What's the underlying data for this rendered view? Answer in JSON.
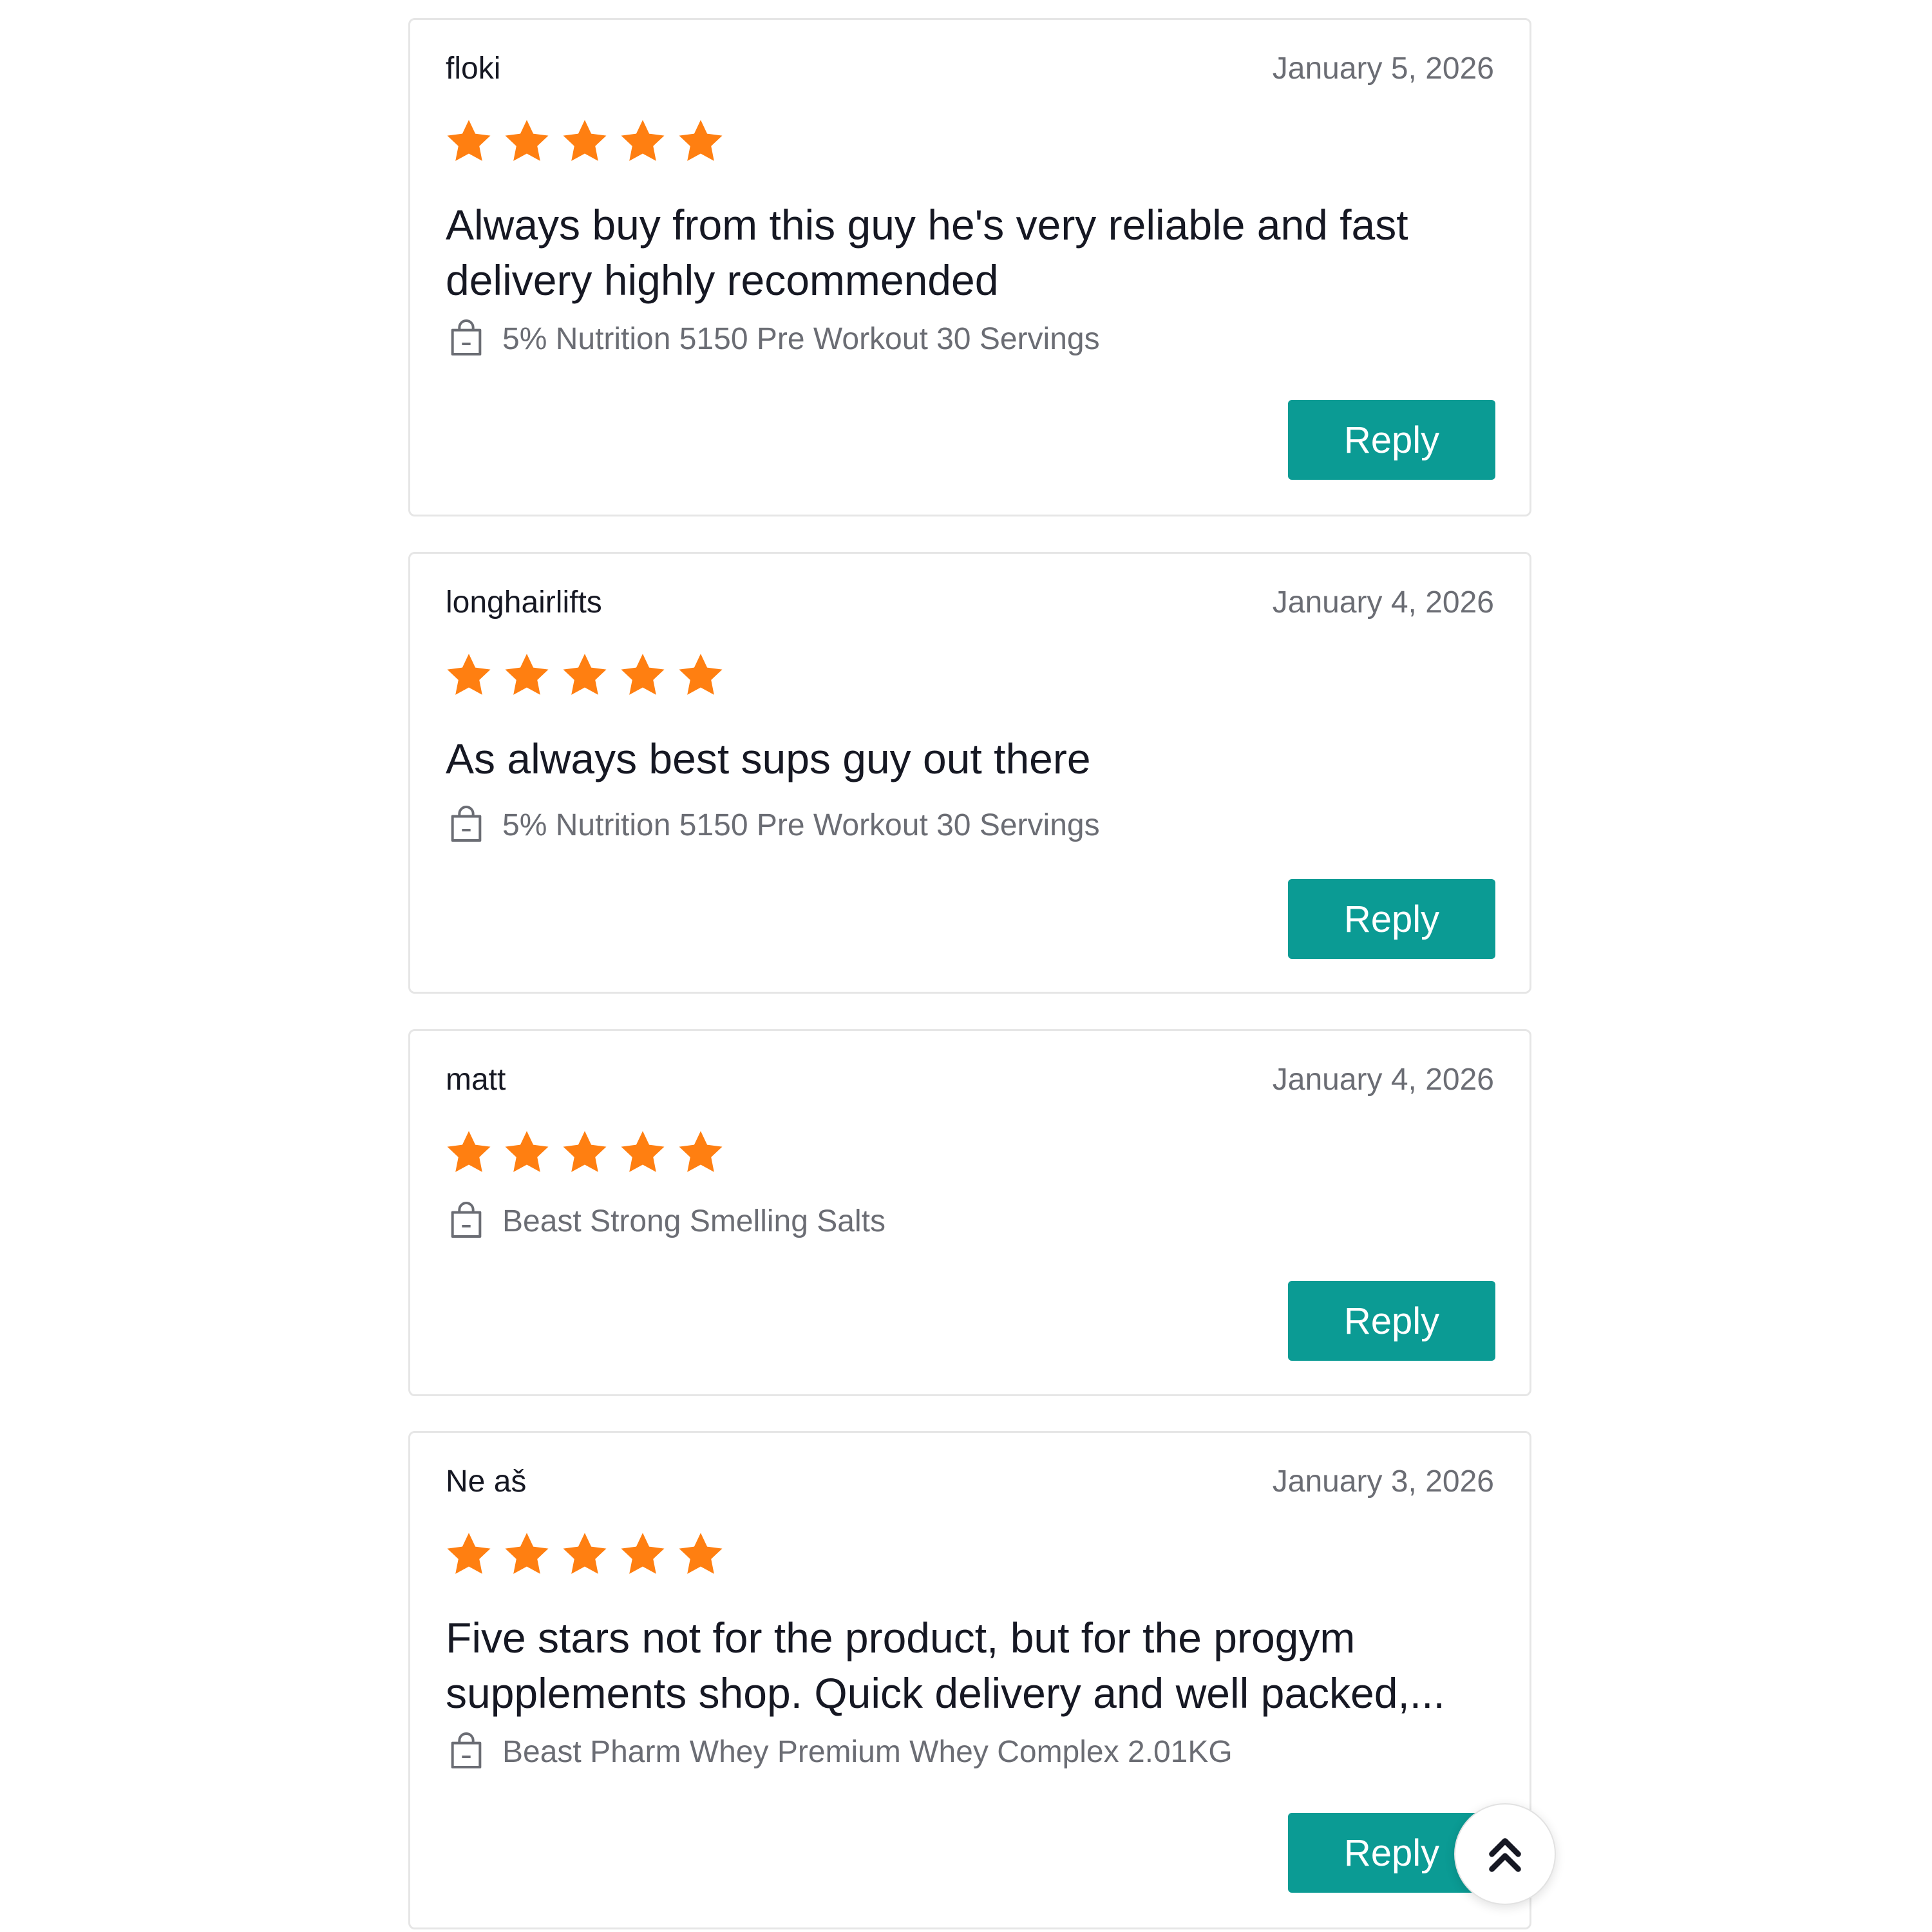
{
  "colors": {
    "star": "#ff7f11",
    "reply_button": "#0b9b94",
    "text_primary": "#161823",
    "text_secondary": "#6b6d74",
    "card_border": "#e6e6e6"
  },
  "reviews": [
    {
      "reviewer": "floki",
      "date": "January 5, 2026",
      "rating": 5,
      "text": "Always buy from this guy he's very reliable and fast\ndelivery highly recommended",
      "product": "5% Nutrition 5150 Pre Workout 30 Servings",
      "reply_label": "Reply"
    },
    {
      "reviewer": "longhairlifts",
      "date": "January 4, 2026",
      "rating": 5,
      "text": "As always best sups guy out there",
      "product": "5% Nutrition 5150 Pre Workout 30 Servings",
      "reply_label": "Reply"
    },
    {
      "reviewer": "matt",
      "date": "January 4, 2026",
      "rating": 5,
      "text": "",
      "product": "Beast Strong Smelling Salts",
      "reply_label": "Reply"
    },
    {
      "reviewer": "Ne aš",
      "date": "January 3, 2026",
      "rating": 5,
      "text": "Five stars not for the product, but for the progym\nsupplements shop. Quick delivery and well packed,...",
      "product": "Beast Pharm Whey Premium Whey Complex 2.01KG",
      "reply_label": "Reply"
    }
  ],
  "icons": {
    "star": "star-icon",
    "product": "shopping-bag-icon",
    "scroll_top": "double-chevron-up-icon"
  }
}
